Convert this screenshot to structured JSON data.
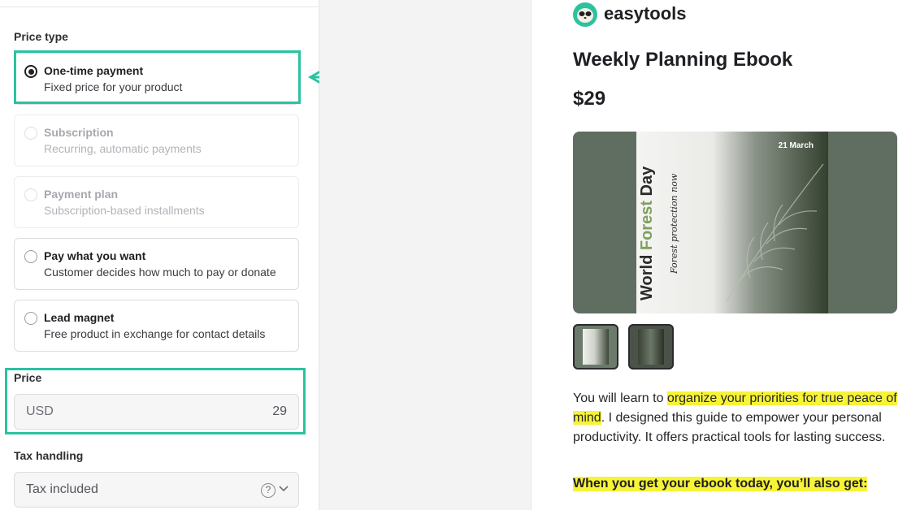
{
  "form": {
    "price_type_label": "Price type",
    "options": [
      {
        "title": "One-time payment",
        "desc": "Fixed price for your product",
        "selected": true,
        "disabled": false
      },
      {
        "title": "Subscription",
        "desc": "Recurring, automatic payments",
        "selected": false,
        "disabled": true
      },
      {
        "title": "Payment plan",
        "desc": "Subscription-based installments",
        "selected": false,
        "disabled": true
      },
      {
        "title": "Pay what you want",
        "desc": "Customer decides how much to pay or donate",
        "selected": false,
        "disabled": false
      },
      {
        "title": "Lead magnet",
        "desc": "Free product in exchange for contact details",
        "selected": false,
        "disabled": false
      }
    ],
    "price_label": "Price",
    "price_currency": "USD",
    "price_value": "29",
    "tax_label": "Tax handling",
    "tax_value": "Tax included"
  },
  "preview": {
    "brand": "easytools",
    "title": "Weekly Planning Ebook",
    "price": "$29",
    "cover": {
      "title_part1": "World ",
      "title_part2": "Forest",
      "title_part3": " Day",
      "subtitle": "Forest protection now",
      "date": "21 March"
    },
    "description": {
      "part1": "You will learn to ",
      "highlight": "organize your priorities for true peace of mind",
      "part2": ". I designed this guide to empower your personal productivity. It offers practical tools for lasting success."
    },
    "bonus_heading": "When you get your ebook today, you’ll also get:"
  },
  "colors": {
    "accent": "#2cc2a0",
    "highlight": "#f7f336",
    "hero_bg": "#5f6e60"
  }
}
